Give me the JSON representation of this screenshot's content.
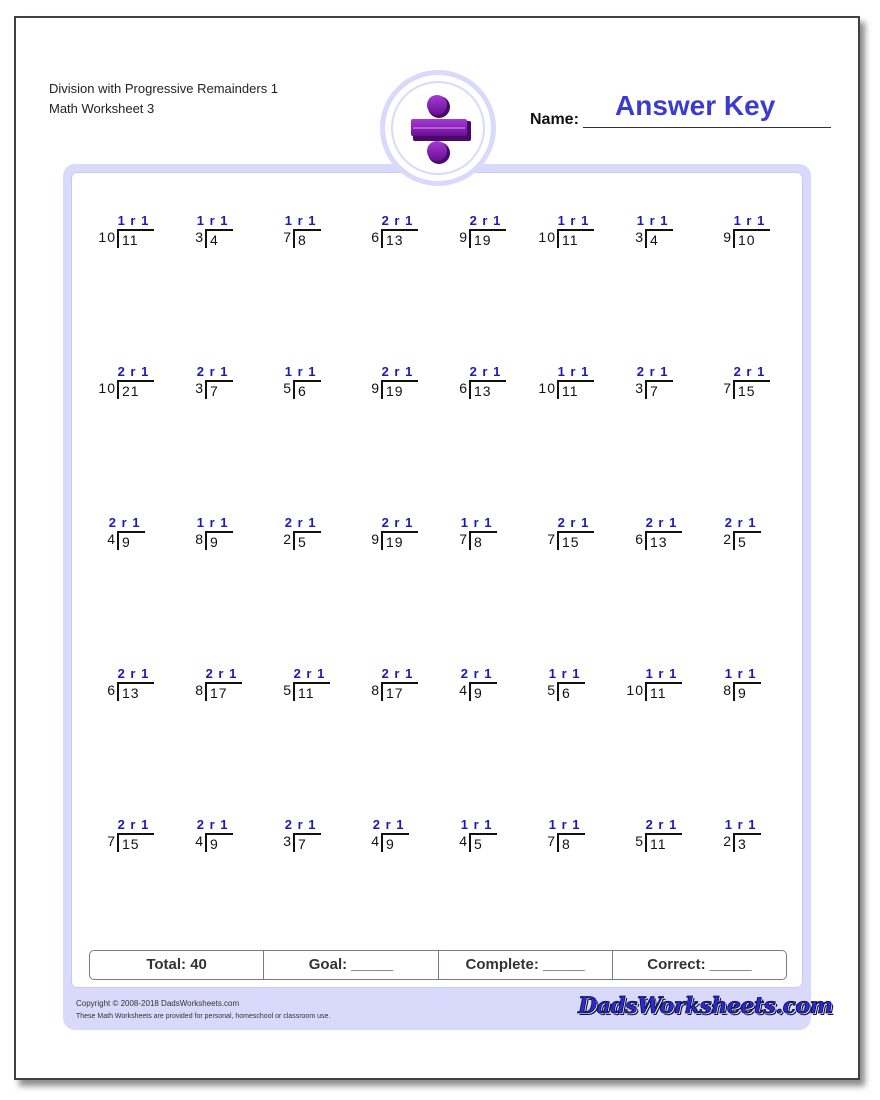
{
  "header": {
    "title_line1": "Division with Progressive Remainders 1",
    "title_line2": "Math Worksheet 3",
    "name_label": "Name:",
    "name_value": "Answer Key",
    "logo_icon": "division-sign-icon"
  },
  "colors": {
    "frame": "#d9d9fb",
    "answer": "#1a1ab8",
    "answer_key": "#3b3bd0",
    "logo": "#7a1aa8"
  },
  "problems": [
    [
      {
        "divisor": "10",
        "dividend": "11",
        "answer": "1 r 1"
      },
      {
        "divisor": "3",
        "dividend": "4",
        "answer": "1 r 1"
      },
      {
        "divisor": "7",
        "dividend": "8",
        "answer": "1 r 1"
      },
      {
        "divisor": "6",
        "dividend": "13",
        "answer": "2 r 1"
      },
      {
        "divisor": "9",
        "dividend": "19",
        "answer": "2 r 1"
      },
      {
        "divisor": "10",
        "dividend": "11",
        "answer": "1 r 1"
      },
      {
        "divisor": "3",
        "dividend": "4",
        "answer": "1 r 1"
      },
      {
        "divisor": "9",
        "dividend": "10",
        "answer": "1 r 1"
      }
    ],
    [
      {
        "divisor": "10",
        "dividend": "21",
        "answer": "2 r 1"
      },
      {
        "divisor": "3",
        "dividend": "7",
        "answer": "2 r 1"
      },
      {
        "divisor": "5",
        "dividend": "6",
        "answer": "1 r 1"
      },
      {
        "divisor": "9",
        "dividend": "19",
        "answer": "2 r 1"
      },
      {
        "divisor": "6",
        "dividend": "13",
        "answer": "2 r 1"
      },
      {
        "divisor": "10",
        "dividend": "11",
        "answer": "1 r 1"
      },
      {
        "divisor": "3",
        "dividend": "7",
        "answer": "2 r 1"
      },
      {
        "divisor": "7",
        "dividend": "15",
        "answer": "2 r 1"
      }
    ],
    [
      {
        "divisor": "4",
        "dividend": "9",
        "answer": "2 r 1"
      },
      {
        "divisor": "8",
        "dividend": "9",
        "answer": "1 r 1"
      },
      {
        "divisor": "2",
        "dividend": "5",
        "answer": "2 r 1"
      },
      {
        "divisor": "9",
        "dividend": "19",
        "answer": "2 r 1"
      },
      {
        "divisor": "7",
        "dividend": "8",
        "answer": "1 r 1"
      },
      {
        "divisor": "7",
        "dividend": "15",
        "answer": "2 r 1"
      },
      {
        "divisor": "6",
        "dividend": "13",
        "answer": "2 r 1"
      },
      {
        "divisor": "2",
        "dividend": "5",
        "answer": "2 r 1"
      }
    ],
    [
      {
        "divisor": "6",
        "dividend": "13",
        "answer": "2 r 1"
      },
      {
        "divisor": "8",
        "dividend": "17",
        "answer": "2 r 1"
      },
      {
        "divisor": "5",
        "dividend": "11",
        "answer": "2 r 1"
      },
      {
        "divisor": "8",
        "dividend": "17",
        "answer": "2 r 1"
      },
      {
        "divisor": "4",
        "dividend": "9",
        "answer": "2 r 1"
      },
      {
        "divisor": "5",
        "dividend": "6",
        "answer": "1 r 1"
      },
      {
        "divisor": "10",
        "dividend": "11",
        "answer": "1 r 1"
      },
      {
        "divisor": "8",
        "dividend": "9",
        "answer": "1 r 1"
      }
    ],
    [
      {
        "divisor": "7",
        "dividend": "15",
        "answer": "2 r 1"
      },
      {
        "divisor": "4",
        "dividend": "9",
        "answer": "2 r 1"
      },
      {
        "divisor": "3",
        "dividend": "7",
        "answer": "2 r 1"
      },
      {
        "divisor": "4",
        "dividend": "9",
        "answer": "2 r 1"
      },
      {
        "divisor": "4",
        "dividend": "5",
        "answer": "1 r 1"
      },
      {
        "divisor": "7",
        "dividend": "8",
        "answer": "1 r 1"
      },
      {
        "divisor": "5",
        "dividend": "11",
        "answer": "2 r 1"
      },
      {
        "divisor": "2",
        "dividend": "3",
        "answer": "1 r 1"
      }
    ]
  ],
  "stats": {
    "total": "Total: 40",
    "goal": "Goal: _____",
    "complete": "Complete: _____",
    "correct": "Correct: _____"
  },
  "footer": {
    "copyright": "Copyright © 2008-2018 DadsWorksheets.com",
    "notice": "These Math Worksheets are provided for personal, homeschool or classroom use.",
    "brand": "DadsWorksheets.com"
  }
}
